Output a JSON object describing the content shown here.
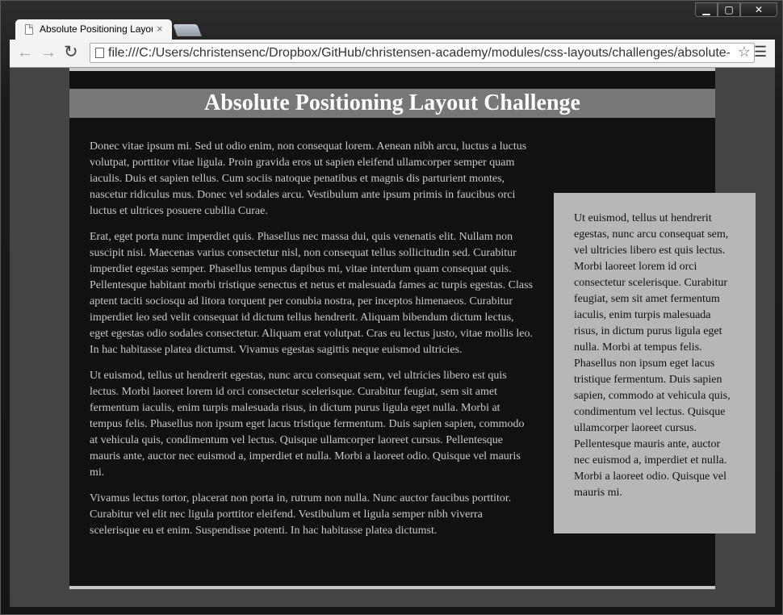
{
  "window": {
    "minimize_glyph": "▁",
    "maximize_glyph": "▢",
    "close_glyph": "✕"
  },
  "tabs": [
    {
      "title": "Absolute Positioning Layout",
      "close_glyph": "×",
      "active": true
    }
  ],
  "toolbar": {
    "back_glyph": "←",
    "forward_glyph": "→",
    "reload_glyph": "↻",
    "url": "file:///C:/Users/christensenc/Dropbox/GitHub/christensen-academy/modules/css-layouts/challenges/absolute-positioning",
    "bookmark_glyph": "☆",
    "menu_glyph": "☰"
  },
  "page": {
    "title": "Absolute Positioning Layout Challenge",
    "paragraphs": [
      "Donec vitae ipsum mi. Sed ut odio enim, non consequat lorem. Aenean nibh arcu, luctus a luctus volutpat, porttitor vitae ligula. Proin gravida eros ut sapien eleifend ullamcorper semper quam iaculis. Duis et sapien tellus. Cum sociis natoque penatibus et magnis dis parturient montes, nascetur ridiculus mus. Donec vel sodales arcu. Vestibulum ante ipsum primis in faucibus orci luctus et ultrices posuere cubilia Curae.",
      "Erat, eget porta nunc imperdiet quis. Phasellus nec massa dui, quis venenatis elit. Nullam non suscipit nisi. Maecenas varius consectetur nisl, non consequat tellus sollicitudin sed. Curabitur imperdiet egestas semper. Phasellus tempus dapibus mi, vitae interdum quam consequat quis. Pellentesque habitant morbi tristique senectus et netus et malesuada fames ac turpis egestas. Class aptent taciti sociosqu ad litora torquent per conubia nostra, per inceptos himenaeos. Curabitur imperdiet leo sed velit consequat id dictum tellus hendrerit. Aliquam bibendum dictum lectus, eget egestas odio sodales consectetur. Aliquam erat volutpat. Cras eu lectus justo, vitae mollis leo. In hac habitasse platea dictumst. Vivamus egestas sagittis neque euismod ultricies.",
      "Ut euismod, tellus ut hendrerit egestas, nunc arcu consequat sem, vel ultricies libero est quis lectus. Morbi laoreet lorem id orci consectetur scelerisque. Curabitur feugiat, sem sit amet fermentum iaculis, enim turpis malesuada risus, in dictum purus ligula eget nulla. Morbi at tempus felis. Phasellus non ipsum eget lacus tristique fermentum. Duis sapien sapien, commodo at vehicula quis, condimentum vel lectus. Quisque ullamcorper laoreet cursus. Pellentesque mauris ante, auctor nec euismod a, imperdiet et nulla. Morbi a laoreet odio. Quisque vel mauris mi.",
      "Vivamus lectus tortor, placerat non porta in, rutrum non nulla. Nunc auctor faucibus porttitor. Curabitur vel elit nec ligula porttitor eleifend. Vestibulum et ligula semper nibh viverra scelerisque eu et enim. Suspendisse potenti. In hac habitasse platea dictumst."
    ],
    "sidebar_text": "Ut euismod, tellus ut hendrerit egestas, nunc arcu consequat sem, vel ultricies libero est quis lectus. Morbi laoreet lorem id orci consectetur scelerisque. Curabitur feugiat, sem sit amet fermentum iaculis, enim turpis malesuada risus, in dictum purus ligula eget nulla. Morbi at tempus felis. Phasellus non ipsum eget lacus tristique fermentum. Duis sapien sapien, commodo at vehicula quis, condimentum vel lectus. Quisque ullamcorper laoreet cursus. Pellentesque mauris ante, auctor nec euismod a, imperdiet et nulla. Morbi a laoreet odio. Quisque vel mauris mi."
  },
  "colors": {
    "page_background": "#444444",
    "container_background": "#111111",
    "header_background": "#777777",
    "sidebar_background": "#b7b7b7",
    "border_accent": "#c8c8c8"
  }
}
